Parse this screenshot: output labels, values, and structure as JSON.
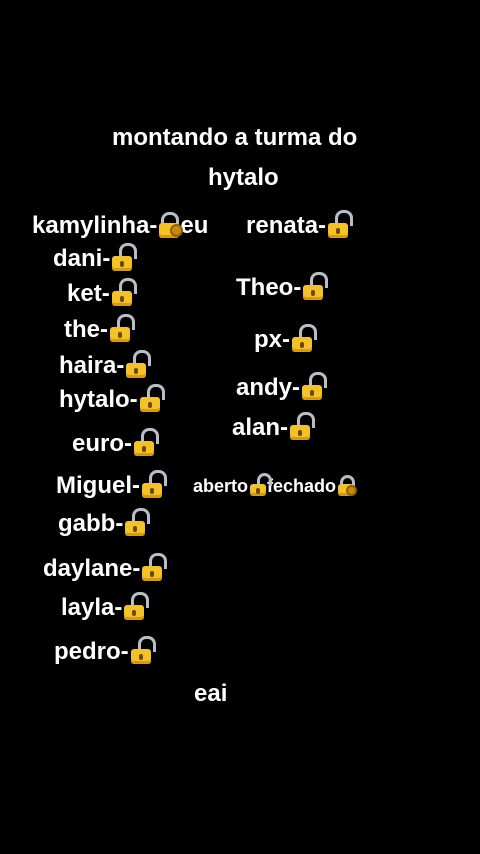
{
  "title_line1": "montando a turma do",
  "title_line2": "hytalo",
  "left_names": [
    "kamylinha-",
    "dani-",
    "ket-",
    "the-",
    "haira-",
    "hytalo-",
    "euro-",
    "Miguel-",
    "gabb-",
    "daylane-",
    "layla-",
    "pedro-"
  ],
  "kamylinha_suffix": "eu",
  "right_names": [
    "renata-",
    "Theo-",
    "px-",
    "andy-",
    "alan-"
  ],
  "legend": {
    "open_label": "aberto",
    "closed_label": "fechado"
  },
  "footer": "eai",
  "icons": {
    "open": "open-lock-icon",
    "closed": "locked-with-key-icon"
  },
  "colors": {
    "background": "#000000",
    "text": "#ffffff",
    "lock_body": "#f3c227"
  }
}
